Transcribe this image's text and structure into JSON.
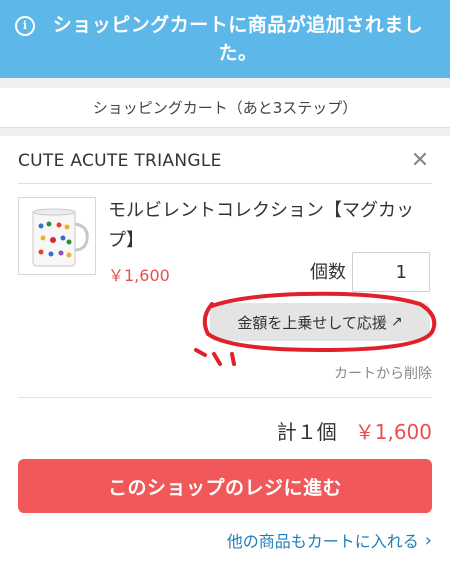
{
  "notification": {
    "icon": "info-icon",
    "text": "ショッピングカートに商品が追加されました。"
  },
  "header": {
    "step_title": "ショッピングカート（あと3ステップ）"
  },
  "shop": {
    "name": "CUTE ACUTE TRIANGLE",
    "close_icon": "close-icon"
  },
  "item": {
    "title": "モルビレントコレクション【マグカップ】",
    "price": "￥1,600",
    "quantity_label": "個数",
    "quantity": "1",
    "thumbnail_icon": "mug-image"
  },
  "support_button": {
    "label": "金額を上乗せして応援",
    "icon": "external-arrow-icon"
  },
  "remove_link": "カートから削除",
  "total": {
    "label": "計１個",
    "price": "￥1,600"
  },
  "checkout_button": "このショップのレジに進む",
  "more_link": {
    "label": "他の商品もカートに入れる",
    "icon": "chevron-right-icon"
  },
  "colors": {
    "notification_bg": "#5db7e8",
    "price": "#e8504f",
    "checkout_bg": "#f0585a",
    "link": "#1e7fb8",
    "annotation": "#e0202a"
  }
}
